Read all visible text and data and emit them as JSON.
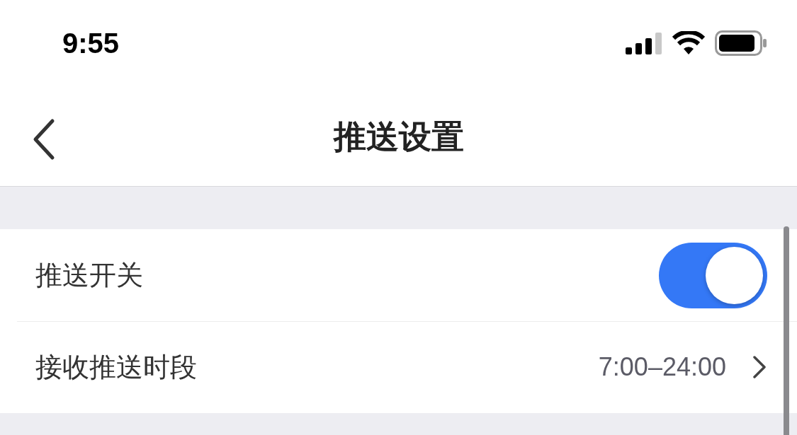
{
  "status_bar": {
    "time": "9:55"
  },
  "nav": {
    "title": "推送设置"
  },
  "settings": [
    {
      "kind": "toggle",
      "label": "推送开关",
      "on": true
    },
    {
      "kind": "link",
      "label": "接收推送时段",
      "value": "7:00–24:00"
    }
  ]
}
